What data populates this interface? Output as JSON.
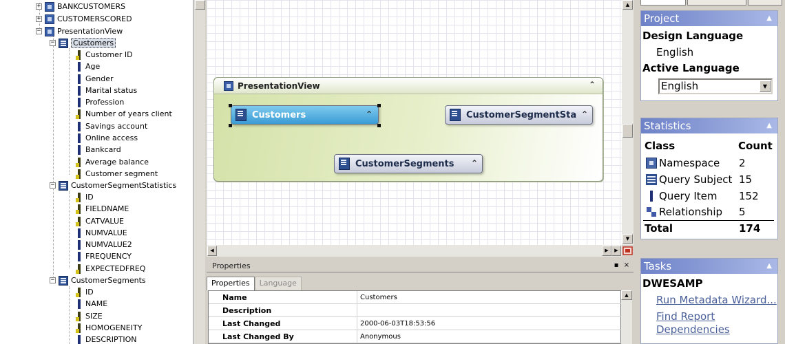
{
  "tree": {
    "items": [
      {
        "label": "BANKCUSTOMERS",
        "expander": "+"
      },
      {
        "label": "CUSTOMERSCORED",
        "expander": "+"
      },
      {
        "label": "PresentationView",
        "expander": "−"
      },
      {
        "label": "Customers",
        "expander": "−"
      },
      {
        "label": "Customer ID"
      },
      {
        "label": "Age"
      },
      {
        "label": "Gender"
      },
      {
        "label": "Marital status"
      },
      {
        "label": "Profession"
      },
      {
        "label": "Number of years client"
      },
      {
        "label": "Savings account"
      },
      {
        "label": "Online access"
      },
      {
        "label": "Bankcard"
      },
      {
        "label": "Average balance"
      },
      {
        "label": "Customer segment"
      },
      {
        "label": "CustomerSegmentStatistics",
        "expander": "−"
      },
      {
        "label": "ID"
      },
      {
        "label": "FIELDNAME"
      },
      {
        "label": "CATVALUE"
      },
      {
        "label": "NUMVALUE"
      },
      {
        "label": "NUMVALUE2"
      },
      {
        "label": "FREQUENCY"
      },
      {
        "label": "EXPECTEDFREQ"
      },
      {
        "label": "CustomerSegments",
        "expander": "−"
      },
      {
        "label": "ID"
      },
      {
        "label": "NAME"
      },
      {
        "label": "SIZE"
      },
      {
        "label": "HOMOGENEITY"
      },
      {
        "label": "DESCRIPTION"
      }
    ]
  },
  "diagram": {
    "frame_title": "PresentationView",
    "collapse_glyph": "⌃",
    "nodes": {
      "customers": "Customers",
      "segment_stats": "CustomerSegmentSta",
      "segments": "CustomerSegments"
    }
  },
  "properties": {
    "title": "Properties",
    "close": "×",
    "pin": "▪",
    "tabs": [
      "Properties",
      "Language"
    ],
    "rows": [
      {
        "key": "Name",
        "value": "Customers"
      },
      {
        "key": "Description",
        "value": ""
      },
      {
        "key": "Last Changed",
        "value": "2000-06-03T18:53:56"
      },
      {
        "key": "Last Changed By",
        "value": "Anonymous"
      }
    ]
  },
  "right": {
    "project": {
      "header": "Project",
      "design_language_label": "Design Language",
      "design_language": "English",
      "active_language_label": "Active Language",
      "active_language": "English"
    },
    "statistics": {
      "header": "Statistics",
      "col_class": "Class",
      "col_count": "Count",
      "rows": [
        {
          "cls": "Namespace",
          "count": "2",
          "icon": "namespace-icon"
        },
        {
          "cls": "Query Subject",
          "count": "15",
          "icon": "query-subject-icon"
        },
        {
          "cls": "Query Item",
          "count": "152",
          "icon": "query-item-icon"
        },
        {
          "cls": "Relationship",
          "count": "5",
          "icon": "relationship-icon"
        }
      ],
      "total_label": "Total",
      "total": "174"
    },
    "tasks": {
      "header": "Tasks",
      "group": "DWESAMP",
      "links": [
        "Run Metadata Wizard...",
        "Find Report",
        "Dependencies"
      ]
    }
  }
}
